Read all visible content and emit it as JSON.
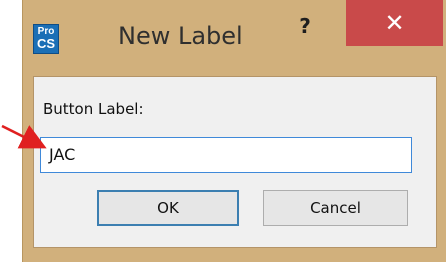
{
  "window": {
    "title": "New Label",
    "app_icon": {
      "name": "procs-app-icon",
      "line1": "Pro",
      "line2": "CS"
    },
    "help_symbol": "?",
    "close_symbol": "✕"
  },
  "form": {
    "label": "Button Label:",
    "value": "JAC"
  },
  "buttons": {
    "ok": "OK",
    "cancel": "Cancel"
  },
  "annotation": {
    "arrow_color": "#e02020"
  },
  "colors": {
    "frame": "#d1b07c",
    "close_button": "#c94a4a",
    "input_border": "#3f89d9"
  }
}
